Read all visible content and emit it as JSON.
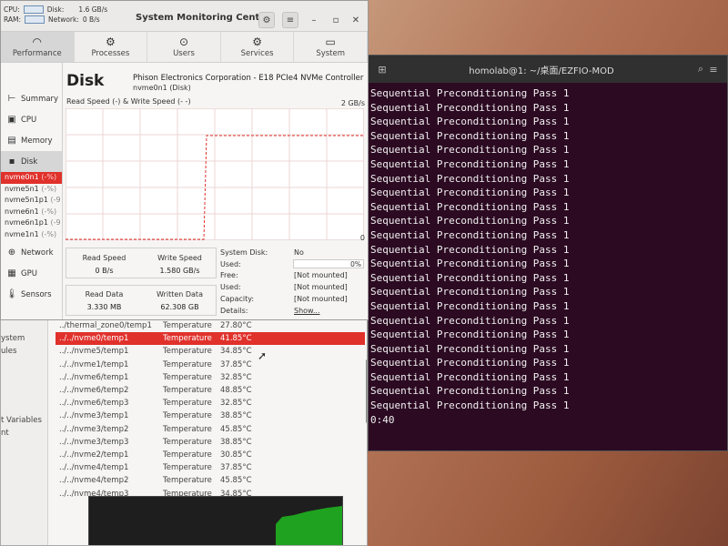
{
  "terminal": {
    "title": "homolab@1: ~/桌面/EZFIO-MOD",
    "lines": [
      "Sequential Preconditioning Pass 1",
      "Sequential Preconditioning Pass 1",
      "Sequential Preconditioning Pass 1",
      "Sequential Preconditioning Pass 1",
      "Sequential Preconditioning Pass 1",
      "Sequential Preconditioning Pass 1",
      "Sequential Preconditioning Pass 1",
      "Sequential Preconditioning Pass 1",
      "Sequential Preconditioning Pass 1",
      "Sequential Preconditioning Pass 1",
      "Sequential Preconditioning Pass 1",
      "Sequential Preconditioning Pass 1",
      "Sequential Preconditioning Pass 1",
      "Sequential Preconditioning Pass 1",
      "Sequential Preconditioning Pass 1",
      "Sequential Preconditioning Pass 1",
      "Sequential Preconditioning Pass 1",
      "Sequential Preconditioning Pass 1",
      "Sequential Preconditioning Pass 1",
      "Sequential Preconditioning Pass 1",
      "Sequential Preconditioning Pass 1",
      "Sequential Preconditioning Pass 1",
      "Sequential Preconditioning Pass 1",
      "0:40"
    ]
  },
  "monitor": {
    "title": "System Monitoring Center",
    "mini": {
      "cpu_label": "CPU:",
      "disk_label": "Disk:",
      "disk_value": "1.6 GB/s",
      "ram_label": "RAM:",
      "network_label": "Network:",
      "network_value": "0 B/s"
    },
    "tabs": [
      {
        "label": "Performance",
        "icon": "gauge-icon"
      },
      {
        "label": "Processes",
        "icon": "gear-icon"
      },
      {
        "label": "Users",
        "icon": "mouse-icon"
      },
      {
        "label": "Services",
        "icon": "gears-icon"
      },
      {
        "label": "System",
        "icon": "monitor-icon"
      }
    ],
    "sidebar": {
      "summary": "Summary",
      "cpu": "CPU",
      "memory": "Memory",
      "disk": "Disk",
      "network": "Network",
      "gpu": "GPU",
      "sensors": "Sensors"
    },
    "disks": [
      {
        "name": "nvme0n1",
        "pct": "(-%)"
      },
      {
        "name": "nvme5n1",
        "pct": "(-%)"
      },
      {
        "name": "nvme5n1p1",
        "pct": "(-9"
      },
      {
        "name": "nvme6n1",
        "pct": "(-%)"
      },
      {
        "name": "nvme6n1p1",
        "pct": "(-9"
      },
      {
        "name": "nvme1n1",
        "pct": "(-%)"
      }
    ],
    "disk_panel": {
      "heading": "Disk",
      "model": "Phison Electronics Corporation - E18 PCIe4 NVMe Controller",
      "device": "nvme0n1  (Disk)",
      "speed_label": "Read Speed (-) & Write Speed (- -)",
      "graph_max": "2 GB/s",
      "graph_zero": "0",
      "read_speed_label": "Read Speed",
      "read_speed": "0 B/s",
      "write_speed_label": "Write Speed",
      "write_speed": "1.580 GB/s",
      "read_data_label": "Read Data",
      "read_data": "3.330 MB",
      "written_data_label": "Written Data",
      "written_data": "62.308 GB",
      "info": [
        {
          "key": "System Disk:",
          "value": "No"
        },
        {
          "key": "Used:",
          "value": ""
        },
        {
          "key": "Free:",
          "value": "[Not mounted]"
        },
        {
          "key": "Used:",
          "value": "[Not mounted]"
        },
        {
          "key": "Capacity:",
          "value": "[Not mounted]"
        },
        {
          "key": "Details:",
          "value": "Show..."
        }
      ],
      "usage_pct": "0%"
    }
  },
  "sensors": {
    "left_items": [
      "ystem",
      "ules",
      "t Variables",
      "nt"
    ],
    "rows": [
      {
        "name": "../thermal_zone0/temp1",
        "type": "Temperature",
        "value": "27.80°C"
      },
      {
        "name": "../../nvme0/temp1",
        "type": "Temperature",
        "value": "41.85°C"
      },
      {
        "name": "../../nvme5/temp1",
        "type": "Temperature",
        "value": "34.85°C"
      },
      {
        "name": "../../nvme1/temp1",
        "type": "Temperature",
        "value": "37.85°C"
      },
      {
        "name": "../../nvme6/temp1",
        "type": "Temperature",
        "value": "32.85°C"
      },
      {
        "name": "../../nvme6/temp2",
        "type": "Temperature",
        "value": "48.85°C"
      },
      {
        "name": "../../nvme6/temp3",
        "type": "Temperature",
        "value": "32.85°C"
      },
      {
        "name": "../../nvme3/temp1",
        "type": "Temperature",
        "value": "38.85°C"
      },
      {
        "name": "../../nvme3/temp2",
        "type": "Temperature",
        "value": "45.85°C"
      },
      {
        "name": "../../nvme3/temp3",
        "type": "Temperature",
        "value": "38.85°C"
      },
      {
        "name": "../../nvme2/temp1",
        "type": "Temperature",
        "value": "30.85°C"
      },
      {
        "name": "../../nvme4/temp1",
        "type": "Temperature",
        "value": "37.85°C"
      },
      {
        "name": "../../nvme4/temp2",
        "type": "Temperature",
        "value": "45.85°C"
      },
      {
        "name": "../../nvme4/temp3",
        "type": "Temperature",
        "value": "34.85°C"
      }
    ]
  },
  "colors": {
    "selection": "#e0312b",
    "terminal_bg": "#2c0a22",
    "graph_line": "#e0312b"
  }
}
